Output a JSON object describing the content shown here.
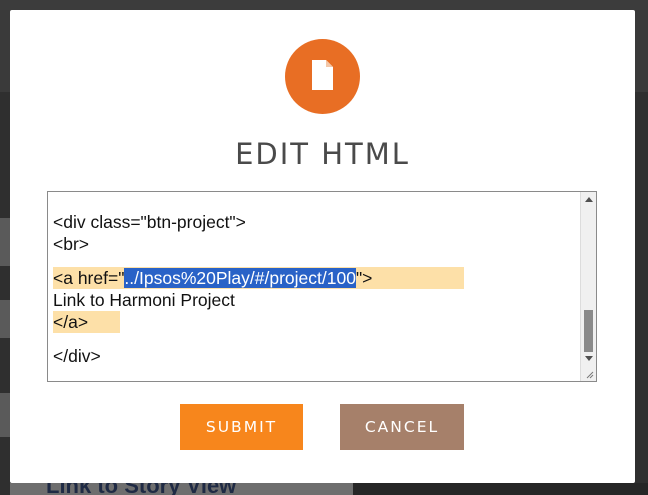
{
  "background": {
    "bottom_link_text": "Link to Story View"
  },
  "modal": {
    "icon": "document-icon",
    "title": "EDIT HTML",
    "accent_color": "#e86e24"
  },
  "editor": {
    "lines": [
      {
        "text": "<div class=\"btn-project\">"
      },
      {
        "text": "<br>"
      },
      {
        "prefix": "<a href=\"",
        "selected": "../Ipsos%20Play/#/project/100",
        "suffix": "\">"
      },
      {
        "text": "Link to Harmoni Project"
      },
      {
        "text": "</a>"
      },
      {
        "text": "</div>"
      }
    ]
  },
  "buttons": {
    "submit_label": "SUBMIT",
    "cancel_label": "CANCEL",
    "submit_color": "#f7861c",
    "cancel_color": "#a6806a"
  }
}
